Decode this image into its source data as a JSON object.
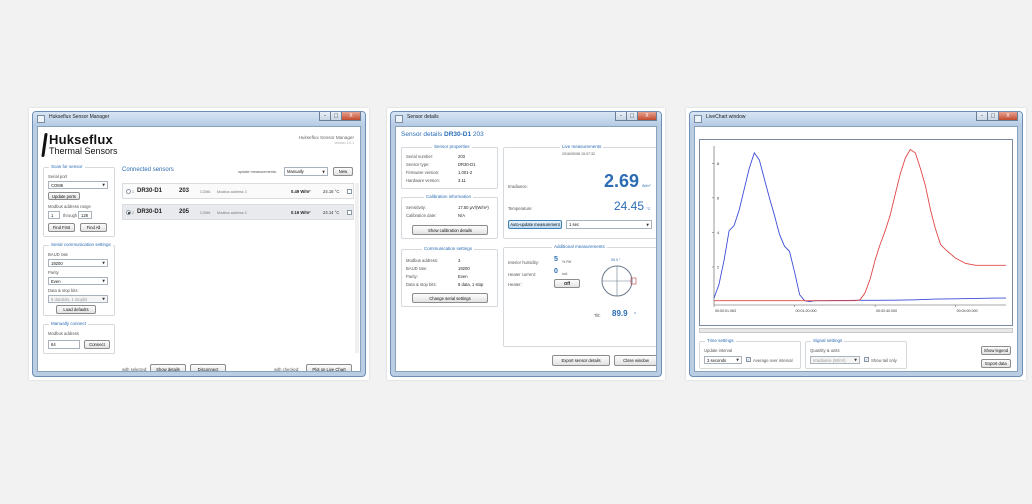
{
  "colors": {
    "accent": "#2b6cb3",
    "line_blue": "#3b4bd8",
    "line_red": "#e04646",
    "close": "#c24a2e"
  },
  "window_controls": {
    "minimize": "–",
    "maximize": "□",
    "close": "X"
  },
  "manager": {
    "title": "Hukseflux Sensor Manager",
    "logo_line1": "Hukseflux",
    "logo_line2": "Thermal Sensors",
    "app_name": "Hukseflux Sensor Manager",
    "version": "version 1.0.1",
    "scan": {
      "legend": "Scan for sensor",
      "serial_port_label": "Serial port",
      "serial_port_value": "COM6",
      "update_ports": "Update ports",
      "modbus_range_label": "Modbus address range",
      "range_from": "1",
      "through_label": "through",
      "range_to": "128",
      "find_first": "Find First",
      "find_all": "Find All"
    },
    "comm": {
      "legend": "Serial communication settings",
      "baud_label": "BAUD rate",
      "baud_value": "19200",
      "parity_label": "Parity",
      "parity_value": "Even",
      "databits_label": "Data & stop bits",
      "databits_value": "8 databits, 1 stopbit",
      "load_defaults": "Load defaults"
    },
    "manual": {
      "legend": "Manually connect",
      "modbus_label": "Modbus address",
      "modbus_value": "64",
      "connect": "Connect"
    },
    "connected_title": "Connected sensors",
    "update_label": "update measurements:",
    "update_value": "Manually",
    "new_button": "New",
    "sensors": [
      {
        "index": "1",
        "name": "DR30-D1",
        "serial": "203",
        "port": "COM6",
        "address": "Modbus address 3",
        "irradiance": "0.49 W/m²",
        "temperature": "24.16 °C"
      },
      {
        "index": "2",
        "name": "DR30-D1",
        "serial": "205",
        "port": "COM6",
        "address": "Modbus address 2",
        "irradiance": "0.16 W/m²",
        "temperature": "24.14 °C"
      }
    ],
    "with_selected": "with selected:",
    "show_details": "Show details",
    "disconnect": "Disconnect",
    "with_checked": "with checked:",
    "plot_chart": "Plot on Live Chart"
  },
  "details": {
    "title": "Sensor details",
    "header_prefix": "Sensor details",
    "header_name": "DR30-D1",
    "header_serial": "203",
    "props": {
      "legend": "Sensor properties",
      "rows": [
        {
          "label": "Serial number:",
          "value": "203"
        },
        {
          "label": "Sensor type:",
          "value": "DR30-D1"
        },
        {
          "label": "Firmware version:",
          "value": "1.001-2"
        },
        {
          "label": "Hardware version:",
          "value": "3.11"
        }
      ]
    },
    "calib": {
      "legend": "Calibration information",
      "rows": [
        {
          "label": "Sensitivity:",
          "value": "17.50 μV/(W/m²)"
        },
        {
          "label": "Calibration date:",
          "value": "N/A"
        }
      ],
      "button": "Show calibration details"
    },
    "comm": {
      "legend": "Communication settings",
      "rows": [
        {
          "label": "Modbus address:",
          "value": "3"
        },
        {
          "label": "BAUD rate:",
          "value": "19200"
        },
        {
          "label": "Parity:",
          "value": "Even"
        },
        {
          "label": "Data & stop bits:",
          "value": "8 data, 1 stop"
        }
      ],
      "button": "Change serial settings"
    },
    "live": {
      "legend": "Live measurements",
      "timestamp": "2016/05/08 15:37:32",
      "irradiance_label": "Irradiance:",
      "irradiance_value": "2.69",
      "irradiance_unit": "W/m²",
      "temperature_label": "Temperature:",
      "temperature_value": "24.45",
      "temperature_unit": "°C",
      "auto_update": "Auto-update measurement",
      "interval": "1 sec"
    },
    "additional": {
      "legend": "Additional measurements",
      "humidity_label": "Interior humidity:",
      "humidity_value": "5",
      "humidity_unit": "% RH",
      "heater_current_label": "Heater current:",
      "heater_current_value": "0",
      "heater_current_unit": "mA",
      "heater_label": "Heater:",
      "heater_state": "Off",
      "tilt_label": "Tilt:",
      "tilt_value": "89.9",
      "tilt_unit": "°",
      "compass_value": "90.0 °"
    },
    "export": "Export sensor details",
    "close": "Close window"
  },
  "livechart": {
    "title": "LiveChart window",
    "time_settings": {
      "legend": "Time settings",
      "interval_label": "Update interval",
      "interval_value": "3 seconds",
      "average_label": "Average over interval"
    },
    "signal_settings": {
      "legend": "Signal settings",
      "quantity_label": "Quantity & units",
      "quantity_value": "Irradiance (W/m²)",
      "tail_label": "Show tail only"
    },
    "show_legend": "Show legend",
    "export": "Export data"
  },
  "chart_data": {
    "type": "line",
    "title": "",
    "xlabel": "",
    "ylabel": "",
    "y_ticks": [
      "8",
      "6",
      "4",
      "2"
    ],
    "x_ticks": [
      "00:00:01.063",
      "00:01:20.000",
      "00:02:40.000",
      "00:04:00.000"
    ],
    "ylim": [
      -0.2,
      9
    ],
    "xlim": [
      0,
      290
    ],
    "series": [
      {
        "color": "#3b4bd8",
        "x": [
          0,
          5,
          10,
          15,
          20,
          25,
          30,
          35,
          40,
          45,
          50,
          55,
          60,
          65,
          70,
          75,
          80,
          85,
          90,
          95,
          100,
          110,
          120,
          130,
          140,
          160,
          180,
          200,
          220,
          240,
          260,
          280,
          290
        ],
        "y": [
          0.2,
          1.0,
          2.4,
          4.1,
          4.4,
          5.3,
          6.5,
          7.7,
          8.6,
          8.2,
          7.1,
          6.0,
          5.0,
          3.9,
          3.2,
          2.9,
          1.7,
          0.4,
          0.05,
          0.0,
          0.05,
          0.05,
          0.06,
          0.06,
          0.07,
          0.07,
          0.08,
          0.1,
          0.14,
          0.16,
          0.18,
          0.2,
          0.2
        ]
      },
      {
        "color": "#e04646",
        "x": [
          0,
          40,
          80,
          110,
          130,
          140,
          145,
          150,
          155,
          160,
          165,
          170,
          175,
          180,
          185,
          190,
          195,
          200,
          205,
          210,
          215,
          220,
          225,
          230,
          240,
          250,
          260,
          270,
          280,
          290
        ],
        "y": [
          0.05,
          0.05,
          0.05,
          0.05,
          0.05,
          0.05,
          0.1,
          0.5,
          1.3,
          2.4,
          3.3,
          4.1,
          5.0,
          6.2,
          7.4,
          8.3,
          8.8,
          8.6,
          7.7,
          6.7,
          5.3,
          4.2,
          3.3,
          3.0,
          2.5,
          2.2,
          2.1,
          2.1,
          2.1,
          2.1
        ]
      }
    ]
  }
}
